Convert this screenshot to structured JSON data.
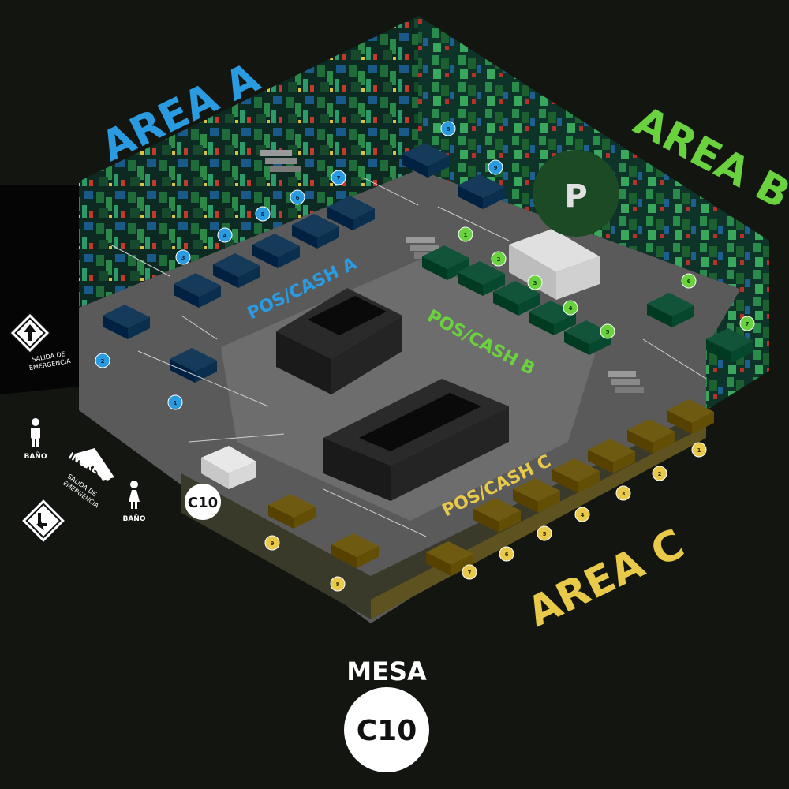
{
  "areas": {
    "a": {
      "label": "AREA A",
      "color": "#2a9be0"
    },
    "b": {
      "label": "AREA B",
      "color": "#6ad23f"
    },
    "c": {
      "label": "AREA C",
      "color": "#e8c94a"
    }
  },
  "pos": {
    "a": "POS/CASH A",
    "b": "POS/CASH B",
    "c": "POS/CASH C"
  },
  "signs": {
    "salida_top": "SALIDA DE EMERGENCIA",
    "salida_bottom": "SALIDA DE EMERGENCIA",
    "bano_left": "BAÑO",
    "bano_right": "BAÑO",
    "ingreso": "INGRESO"
  },
  "tables": {
    "a": [
      "1",
      "2",
      "3",
      "4",
      "5",
      "6",
      "7",
      "8",
      "9"
    ],
    "b": [
      "1",
      "2",
      "3",
      "4",
      "5",
      "6",
      "7"
    ],
    "c": [
      "1",
      "2",
      "3",
      "4",
      "5",
      "6",
      "7",
      "8",
      "9"
    ]
  },
  "selected": {
    "heading": "MESA",
    "table": "C10",
    "marker": "C10"
  },
  "colors": {
    "background": "#121510",
    "floor": "#5f5f5f",
    "sofa_a": "#163a5a",
    "sofa_b": "#12543a",
    "sofa_c": "#6f5a12"
  },
  "icons": [
    "up-arrow-icon",
    "down-left-arrow-icon",
    "man-icon",
    "woman-icon",
    "ingreso-arrow-icon"
  ]
}
